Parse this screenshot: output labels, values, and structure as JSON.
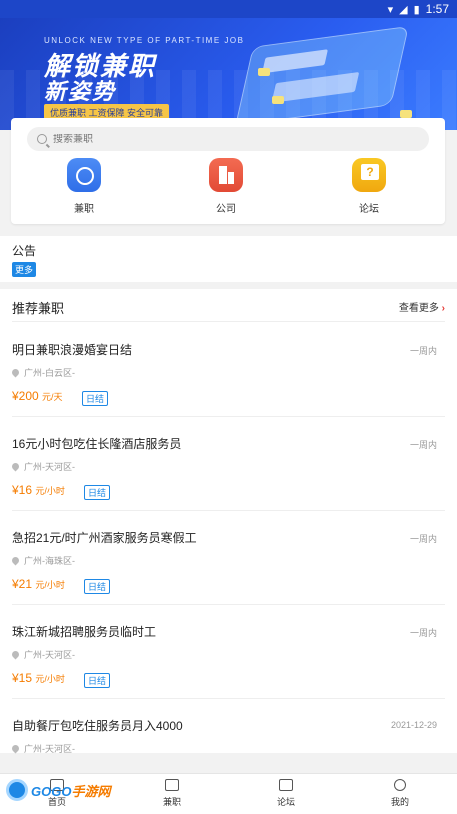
{
  "status": {
    "time": "1:57"
  },
  "banner": {
    "subtitle_en": "UNLOCK NEW TYPE OF PART-TIME JOB",
    "title_line1": "解锁兼职",
    "title_line2": "新姿势",
    "tagline": "优质兼职 工资保障 安全可靠"
  },
  "search": {
    "placeholder": "搜索兼职"
  },
  "categories": [
    {
      "label": "兼职",
      "icon": "clock-badge-icon"
    },
    {
      "label": "公司",
      "icon": "building-icon"
    },
    {
      "label": "论坛",
      "icon": "question-bubble-icon"
    }
  ],
  "notice": {
    "title": "公告",
    "more": "更多"
  },
  "recommend": {
    "title": "推荐兼职",
    "more": "查看更多",
    "jobs": [
      {
        "title": "明日兼职浪漫婚宴日结",
        "time": "一周内",
        "location": "广州-白云区-",
        "pay": "¥200",
        "unit": "元/天",
        "badge": "日结"
      },
      {
        "title": "16元小时包吃住长隆酒店服务员",
        "time": "一周内",
        "location": "广州-天河区-",
        "pay": "¥16",
        "unit": "元/小时",
        "badge": "日结"
      },
      {
        "title": "急招21元/时广州酒家服务员寒假工",
        "time": "一周内",
        "location": "广州-海珠区-",
        "pay": "¥21",
        "unit": "元/小时",
        "badge": "日结"
      },
      {
        "title": "珠江新城招聘服务员临时工",
        "time": "一周内",
        "location": "广州-天河区-",
        "pay": "¥15",
        "unit": "元/小时",
        "badge": "日结"
      },
      {
        "title": "自助餐厅包吃住服务员月入4000",
        "time": "2021-12-29",
        "location": "广州-天河区-"
      }
    ]
  },
  "tabs": [
    {
      "label": "首页",
      "icon": "home-icon"
    },
    {
      "label": "兼职",
      "icon": "briefcase-icon"
    },
    {
      "label": "论坛",
      "icon": "chat-icon"
    },
    {
      "label": "我的",
      "icon": "user-icon"
    }
  ],
  "watermark": {
    "text_a": "GOGO",
    "text_b": "手游网"
  }
}
